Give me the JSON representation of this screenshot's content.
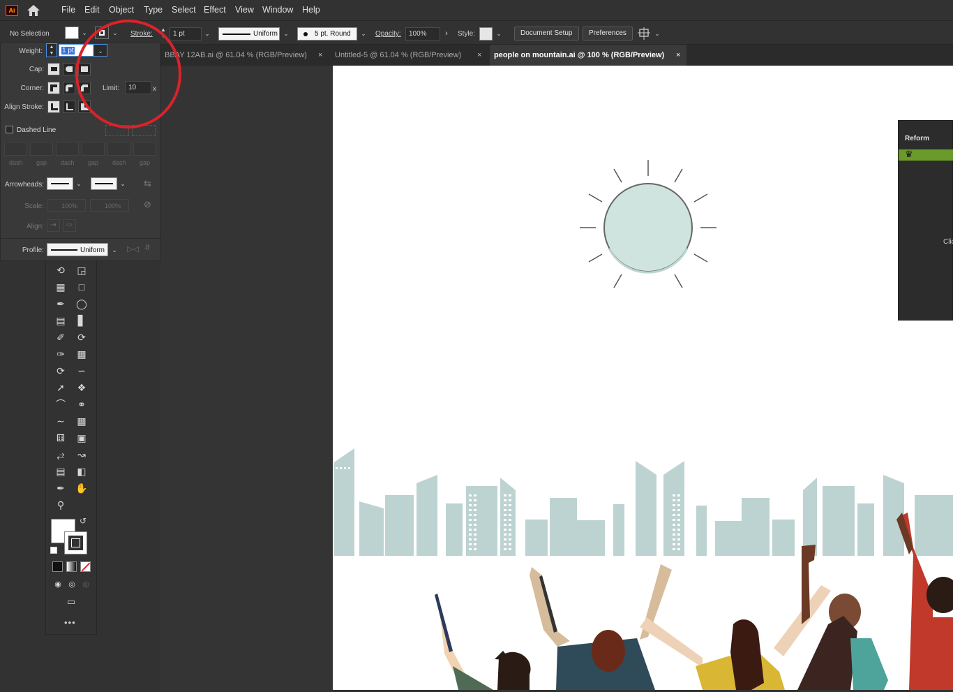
{
  "app": {
    "logo": "Ai",
    "home_icon": "home-icon"
  },
  "menu": [
    "File",
    "Edit",
    "Object",
    "Type",
    "Select",
    "Effect",
    "View",
    "Window",
    "Help"
  ],
  "control_bar": {
    "selection": "No Selection",
    "stroke_label": "Stroke:",
    "stroke_weight": "1 pt",
    "profile": "Uniform",
    "brush": "5 pt. Round",
    "opacity_label": "Opacity:",
    "opacity": "100%",
    "style_label": "Style:",
    "document_setup": "Document Setup",
    "preferences": "Preferences"
  },
  "tabs": [
    {
      "label": "BBAY 12AB.ai @ 61.04 % (RGB/Preview)",
      "active": false
    },
    {
      "label": "Untitled-5 @ 61.04 % (RGB/Preview)",
      "active": false
    },
    {
      "label": "people on mountain.ai @ 100 % (RGB/Preview)",
      "active": true
    }
  ],
  "tab_close": "×",
  "stroke_panel": {
    "weight_label": "Weight:",
    "weight_value": "1 pt",
    "cap_label": "Cap:",
    "corner_label": "Corner:",
    "limit_label": "Limit:",
    "limit_value": "10",
    "limit_unit": "x",
    "align_label": "Align Stroke:",
    "dashed_line": "Dashed Line",
    "dash_labels": [
      "dash",
      "gap",
      "dash",
      "gap",
      "dash",
      "gap"
    ],
    "arrowheads_label": "Arrowheads:",
    "scale_label": "Scale:",
    "scale_start": "100%",
    "scale_end": "100%",
    "align_arrow_label": "Align:",
    "profile_label": "Profile:",
    "profile_value": "Uniform"
  },
  "right_panel": {
    "title": "Reform",
    "partial_text": "Clic"
  },
  "colors": {
    "ui_bg": "#323232",
    "sun_fill": "#cfe3df",
    "city": "#bdd3d1",
    "annotation": "#d9232a",
    "reform_green": "#6a9a2a"
  }
}
